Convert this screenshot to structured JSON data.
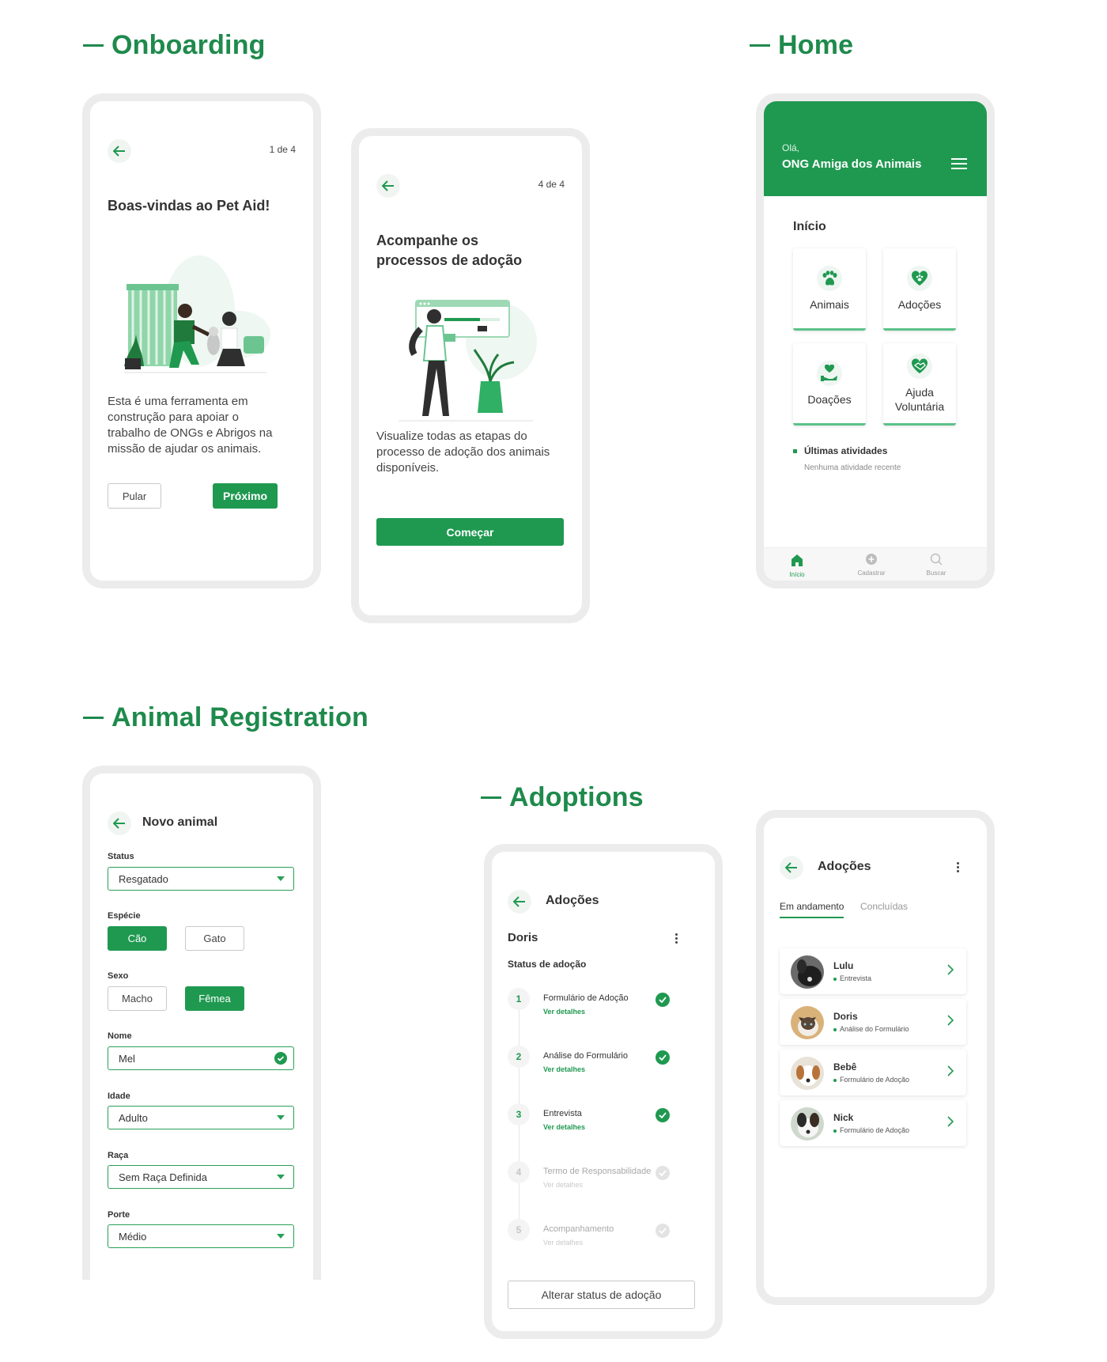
{
  "sections": {
    "onboarding": "Onboarding",
    "home": "Home",
    "animal_registration": "Animal Registration",
    "adoptions": "Adoptions"
  },
  "onboarding1": {
    "step": "1 de 4",
    "title": "Boas-vindas ao Pet Aid!",
    "body": "Esta é uma ferramenta em construção para apoiar o trabalho de ONGs e Abrigos na missão de ajudar os animais.",
    "skip": "Pular",
    "next": "Próximo"
  },
  "onboarding2": {
    "step": "4 de 4",
    "title": "Acompanhe os processos de adoção",
    "body": "Visualize todas as etapas do processo de adoção dos animais disponíveis.",
    "start": "Começar"
  },
  "home": {
    "greeting": "Olá,",
    "org_name": "ONG Amiga dos Animais",
    "section_title": "Início",
    "tiles": [
      {
        "label": "Animais",
        "icon": "paw-icon"
      },
      {
        "label": "Adoções",
        "icon": "heart-paw-icon"
      },
      {
        "label": "Doações",
        "icon": "donation-hand-icon"
      },
      {
        "label": "Ajuda Voluntária",
        "icon": "handshake-heart-icon"
      }
    ],
    "activities_title": "Últimas atividades",
    "activities_empty": "Nenhuma atividade recente",
    "nav": [
      {
        "label": "Início",
        "icon": "home-icon",
        "active": true
      },
      {
        "label": "Cadastrar",
        "icon": "plus-circle-icon",
        "active": false
      },
      {
        "label": "Buscar",
        "icon": "search-icon",
        "active": false
      }
    ]
  },
  "registration": {
    "title": "Novo animal",
    "status_label": "Status",
    "status_value": "Resgatado",
    "species_label": "Espécie",
    "species_options": [
      "Cão",
      "Gato"
    ],
    "species_selected": "Cão",
    "sex_label": "Sexo",
    "sex_options": [
      "Macho",
      "Fêmea"
    ],
    "sex_selected": "Fêmea",
    "name_label": "Nome",
    "name_value": "Mel",
    "age_label": "Idade",
    "age_value": "Adulto",
    "breed_label": "Raça",
    "breed_value": "Sem Raça Definida",
    "size_label": "Porte",
    "size_value": "Médio"
  },
  "adoption_detail": {
    "title": "Adoções",
    "animal": "Doris",
    "status_title": "Status de adoção",
    "steps": [
      {
        "num": "1",
        "title": "Formulário de Adoção",
        "link": "Ver detalhes",
        "done": true
      },
      {
        "num": "2",
        "title": "Análise do Formulário",
        "link": "Ver detalhes",
        "done": true
      },
      {
        "num": "3",
        "title": "Entrevista",
        "link": "Ver detalhes",
        "done": true
      },
      {
        "num": "4",
        "title": "Termo de Responsabilidade",
        "link": "Ver detalhes",
        "done": false
      },
      {
        "num": "5",
        "title": "Acompanhamento",
        "link": "Ver detalhes",
        "done": false
      }
    ],
    "change_button": "Alterar status de adoção"
  },
  "adoption_list": {
    "title": "Adoções",
    "tabs": [
      "Em andamento",
      "Concluídas"
    ],
    "active_tab": "Em andamento",
    "items": [
      {
        "name": "Lulu",
        "status": "Entrevista"
      },
      {
        "name": "Doris",
        "status": "Análise do Formulário"
      },
      {
        "name": "Bebê",
        "status": "Formulário de Adoção"
      },
      {
        "name": "Nick",
        "status": "Formulário de Adoção"
      }
    ]
  },
  "colors": {
    "brand": "#1f9950",
    "title": "#1e8a4c",
    "frame": "#ececec"
  }
}
